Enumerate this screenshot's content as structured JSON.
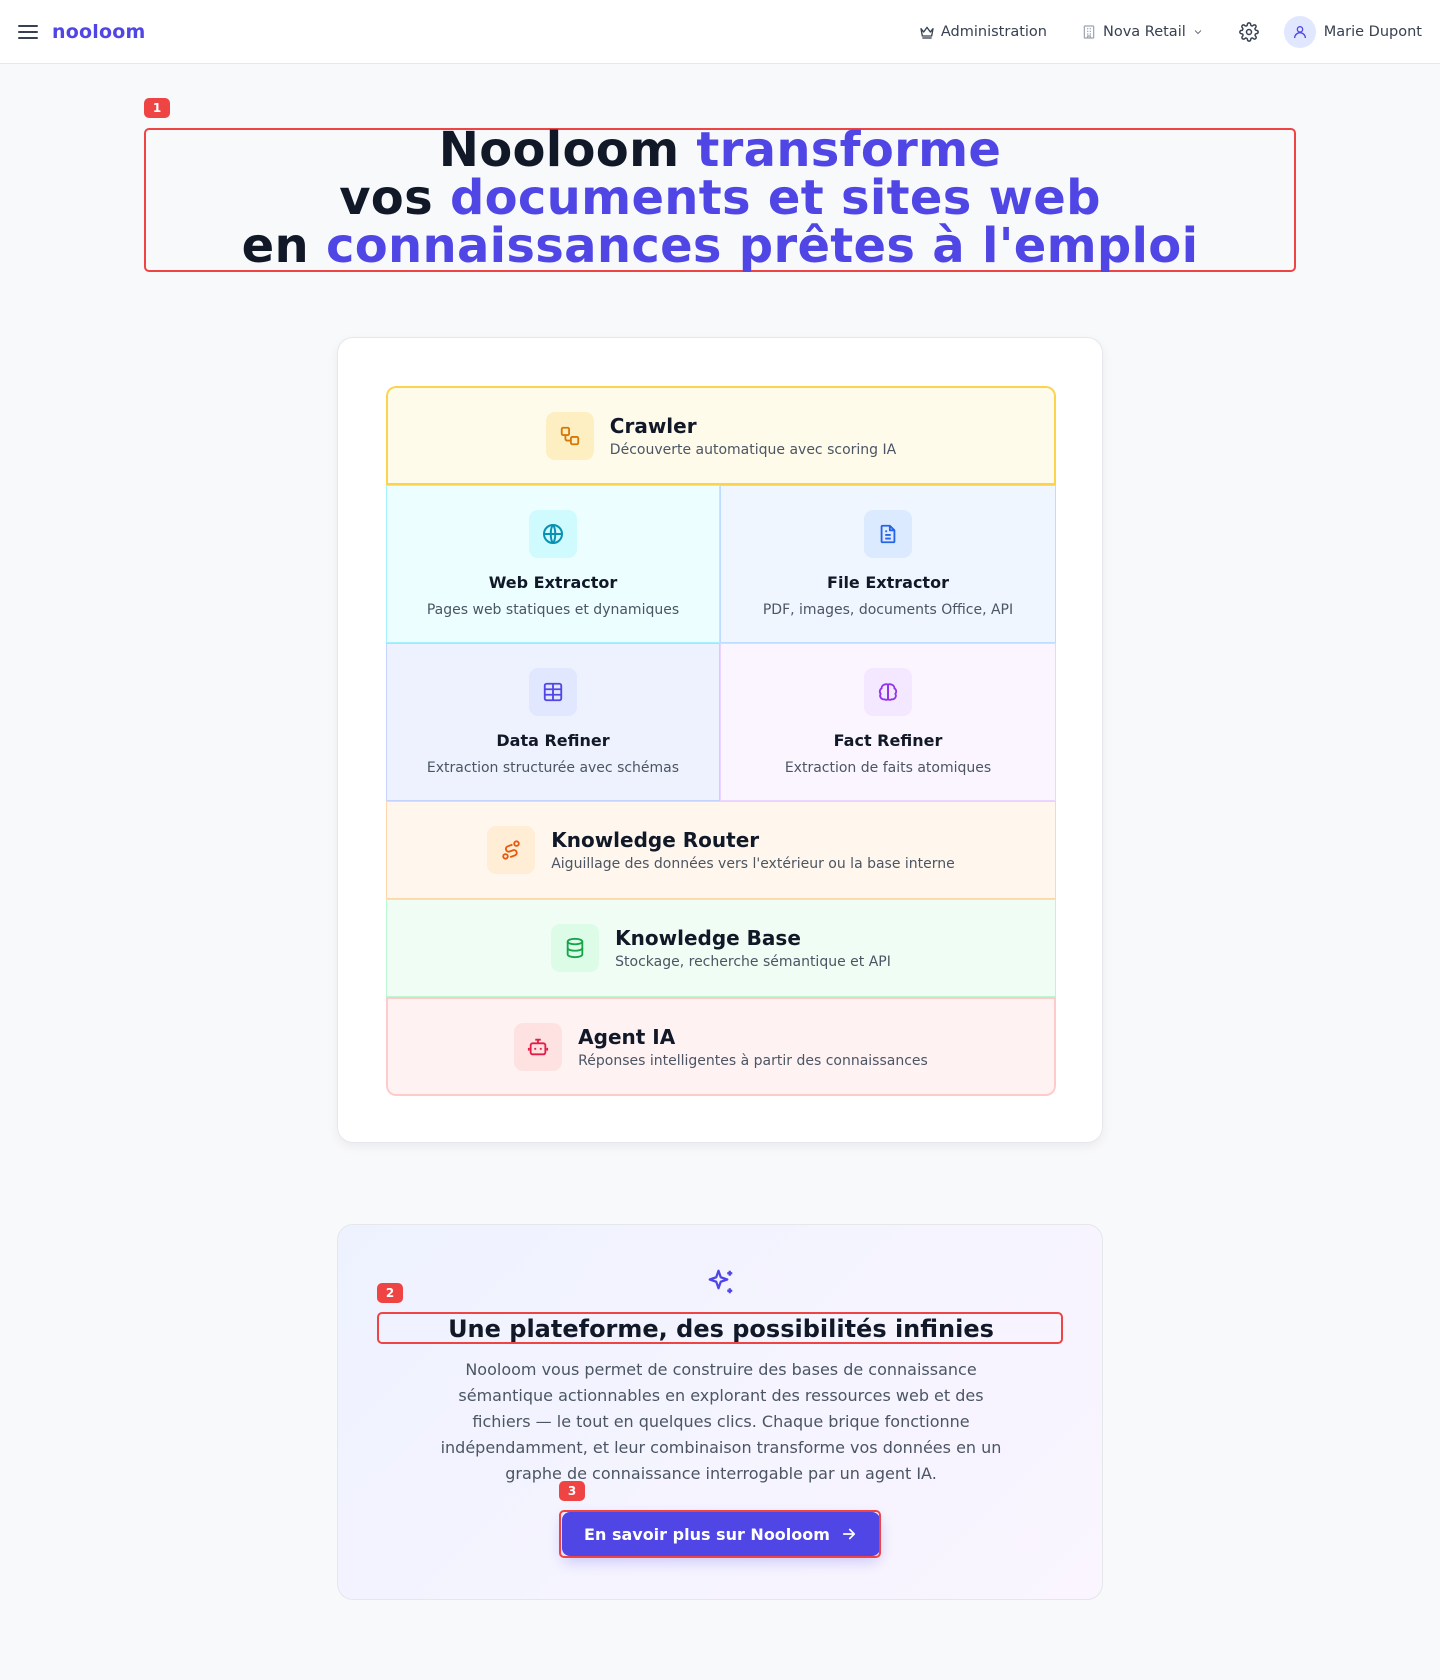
{
  "header": {
    "brand": "nooloom",
    "admin_label": "Administration",
    "org_label": "Nova Retail",
    "user_name": "Marie Dupont"
  },
  "markers": [
    "1",
    "2",
    "3"
  ],
  "hero": {
    "line1_plain": "Nooloom",
    "line1_accent": "transforme",
    "line2_plain": "vos",
    "line2_accent": "documents et sites web",
    "line3_plain": "en",
    "line3_accent": "connaissances prêtes à l'emploi"
  },
  "pipeline": {
    "crawler": {
      "title": "Crawler",
      "subtitle": "Découverte automatique avec scoring IA",
      "icon": "workflow-icon"
    },
    "web_extractor": {
      "title": "Web Extractor",
      "subtitle": "Pages web statiques et dynamiques",
      "icon": "globe-icon"
    },
    "file_extractor": {
      "title": "File Extractor",
      "subtitle": "PDF, images, documents Office, API",
      "icon": "file-text-icon"
    },
    "data_refiner": {
      "title": "Data Refiner",
      "subtitle": "Extraction structurée avec schémas",
      "icon": "table-icon"
    },
    "fact_refiner": {
      "title": "Fact Refiner",
      "subtitle": "Extraction de faits atomiques",
      "icon": "brain-icon"
    },
    "knowledge_router": {
      "title": "Knowledge Router",
      "subtitle": "Aiguillage des données vers l'extérieur ou la base interne",
      "icon": "route-icon"
    },
    "knowledge_base": {
      "title": "Knowledge Base",
      "subtitle": "Stockage, recherche sémantique et API",
      "icon": "database-icon"
    },
    "agent": {
      "title": "Agent IA",
      "subtitle": "Réponses intelligentes à partir des connaissances",
      "icon": "bot-icon"
    }
  },
  "cta": {
    "title": "Une plateforme, des possibilités infinies",
    "text": "Nooloom vous permet de construire des bases de connaissance sémantique actionnables en explorant des ressources web et des fichiers — le tout en quelques clics. Chaque brique fonctionne indépendamment, et leur combinaison transforme vos données en un graphe de connaissance interrogable par un agent IA.",
    "button": "En savoir plus sur Nooloom"
  },
  "colors": {
    "accent": "#4f46e5",
    "marker": "#ef4444",
    "crawler_bg": "#fefbea",
    "web_bg": "#ecfeff",
    "file_bg": "#eff6ff",
    "data_bg": "#eef2ff",
    "fact_bg": "#faf5ff",
    "router_bg": "#fff7ed",
    "kb_bg": "#f0fdf4",
    "agent_bg": "#fef2f2"
  }
}
